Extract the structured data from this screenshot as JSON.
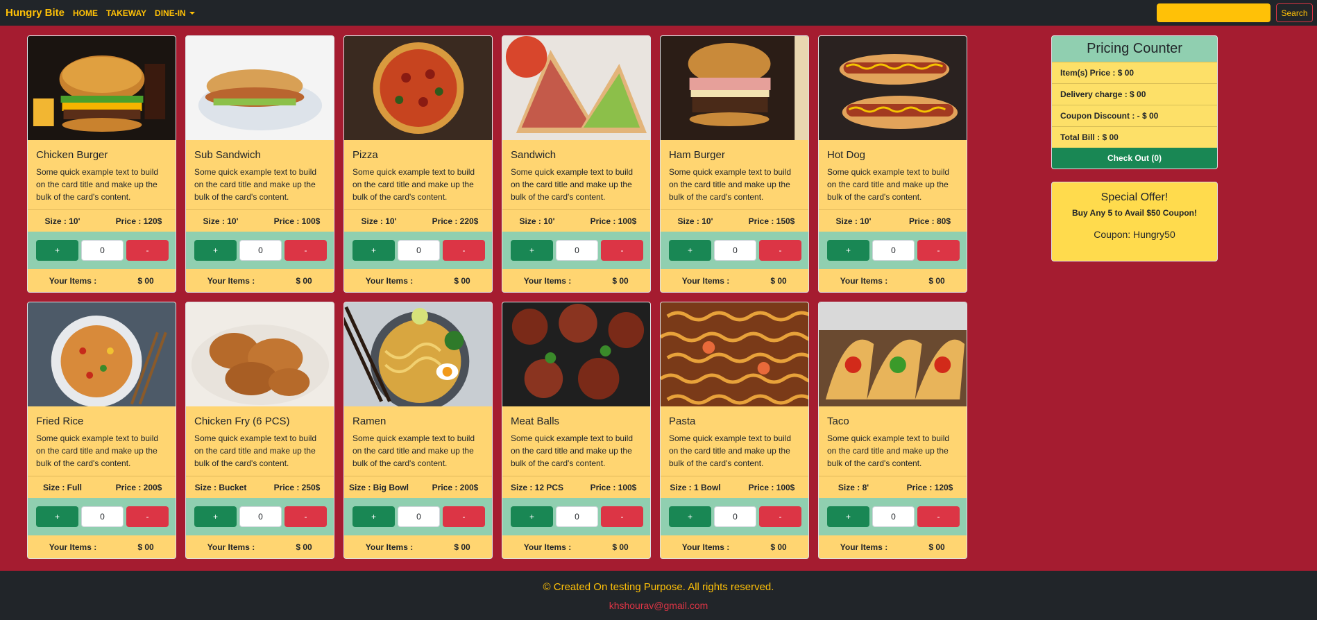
{
  "navbar": {
    "brand": "Hungry Bite",
    "links": [
      "HOME",
      "TAKEWAY",
      "DINE-IN"
    ],
    "search_value": "",
    "search_button": "Search"
  },
  "colors": {
    "accent": "#ffc107",
    "background": "#a51c30",
    "card": "#ffd571",
    "success": "#198754",
    "danger": "#dc3545"
  },
  "cards": [
    {
      "title": "Chicken Burger",
      "text": "Some quick example text to build on the card title and make up the bulk of the card's content.",
      "size": "Size : 10'",
      "price": "Price : 120$",
      "qty": "0",
      "items_label": "Your Items :",
      "items_value": "$ 00",
      "image": "burger-image"
    },
    {
      "title": "Sub Sandwich",
      "text": "Some quick example text to build on the card title and make up the bulk of the card's content.",
      "size": "Size : 10'",
      "price": "Price : 100$",
      "qty": "0",
      "items_label": "Your Items :",
      "items_value": "$ 00",
      "image": "sub-sandwich-image"
    },
    {
      "title": "Pizza",
      "text": "Some quick example text to build on the card title and make up the bulk of the card's content.",
      "size": "Size : 10'",
      "price": "Price : 220$",
      "qty": "0",
      "items_label": "Your Items :",
      "items_value": "$ 00",
      "image": "pizza-image"
    },
    {
      "title": "Sandwich",
      "text": "Some quick example text to build on the card title and make up the bulk of the card's content.",
      "size": "Size : 10'",
      "price": "Price : 100$",
      "qty": "0",
      "items_label": "Your Items :",
      "items_value": "$ 00",
      "image": "sandwich-image"
    },
    {
      "title": "Ham Burger",
      "text": "Some quick example text to build on the card title and make up the bulk of the card's content.",
      "size": "Size : 10'",
      "price": "Price : 150$",
      "qty": "0",
      "items_label": "Your Items :",
      "items_value": "$ 00",
      "image": "ham-burger-image"
    },
    {
      "title": "Hot Dog",
      "text": "Some quick example text to build on the card title and make up the bulk of the card's content.",
      "size": "Size : 10'",
      "price": "Price : 80$",
      "qty": "0",
      "items_label": "Your Items :",
      "items_value": "$ 00",
      "image": "hot-dog-image"
    },
    {
      "title": "Fried Rice",
      "text": "Some quick example text to build on the card title and make up the bulk of the card's content.",
      "size": "Size : Full",
      "price": "Price : 200$",
      "qty": "0",
      "items_label": "Your Items :",
      "items_value": "$ 00",
      "image": "fried-rice-image"
    },
    {
      "title": "Chicken Fry (6 PCS)",
      "text": "Some quick example text to build on the card title and make up the bulk of the card's content.",
      "size": "Size : Bucket",
      "price": "Price : 250$",
      "qty": "0",
      "items_label": "Your Items :",
      "items_value": "$ 00",
      "image": "chicken-fry-image"
    },
    {
      "title": "Ramen",
      "text": "Some quick example text to build on the card title and make up the bulk of the card's content.",
      "size": "Size : Big Bowl",
      "price": "Price : 200$",
      "qty": "0",
      "items_label": "Your Items :",
      "items_value": "$ 00",
      "image": "ramen-image"
    },
    {
      "title": "Meat Balls",
      "text": "Some quick example text to build on the card title and make up the bulk of the card's content.",
      "size": "Size : 12 PCS",
      "price": "Price : 100$",
      "qty": "0",
      "items_label": "Your Items :",
      "items_value": "$ 00",
      "image": "meat-balls-image"
    },
    {
      "title": "Pasta",
      "text": "Some quick example text to build on the card title and make up the bulk of the card's content.",
      "size": "Size : 1 Bowl",
      "price": "Price : 100$",
      "qty": "0",
      "items_label": "Your Items :",
      "items_value": "$ 00",
      "image": "pasta-image"
    },
    {
      "title": "Taco",
      "text": "Some quick example text to build on the card title and make up the bulk of the card's content.",
      "size": "Size : 8'",
      "price": "Price : 120$",
      "qty": "0",
      "items_label": "Your Items :",
      "items_value": "$ 00",
      "image": "taco-image"
    }
  ],
  "buttons": {
    "plus": "+",
    "minus": "-"
  },
  "counter": {
    "title": "Pricing Counter",
    "item_price": "Item(s) Price : $ 00",
    "delivery": "Delivery charge : $ 00",
    "coupon": "Coupon Discount : - $ 00",
    "total": "Total Bill : $ 00",
    "checkout": "Check Out (0)"
  },
  "offer": {
    "title": "Special Offer!",
    "subtitle": "Buy Any 5 to Avail $50 Coupon!",
    "code": "Coupon: Hungry50"
  },
  "footer": {
    "text": "© Created On testing Purpose. All rights reserved.",
    "email": "khshourav@gmail.com"
  }
}
